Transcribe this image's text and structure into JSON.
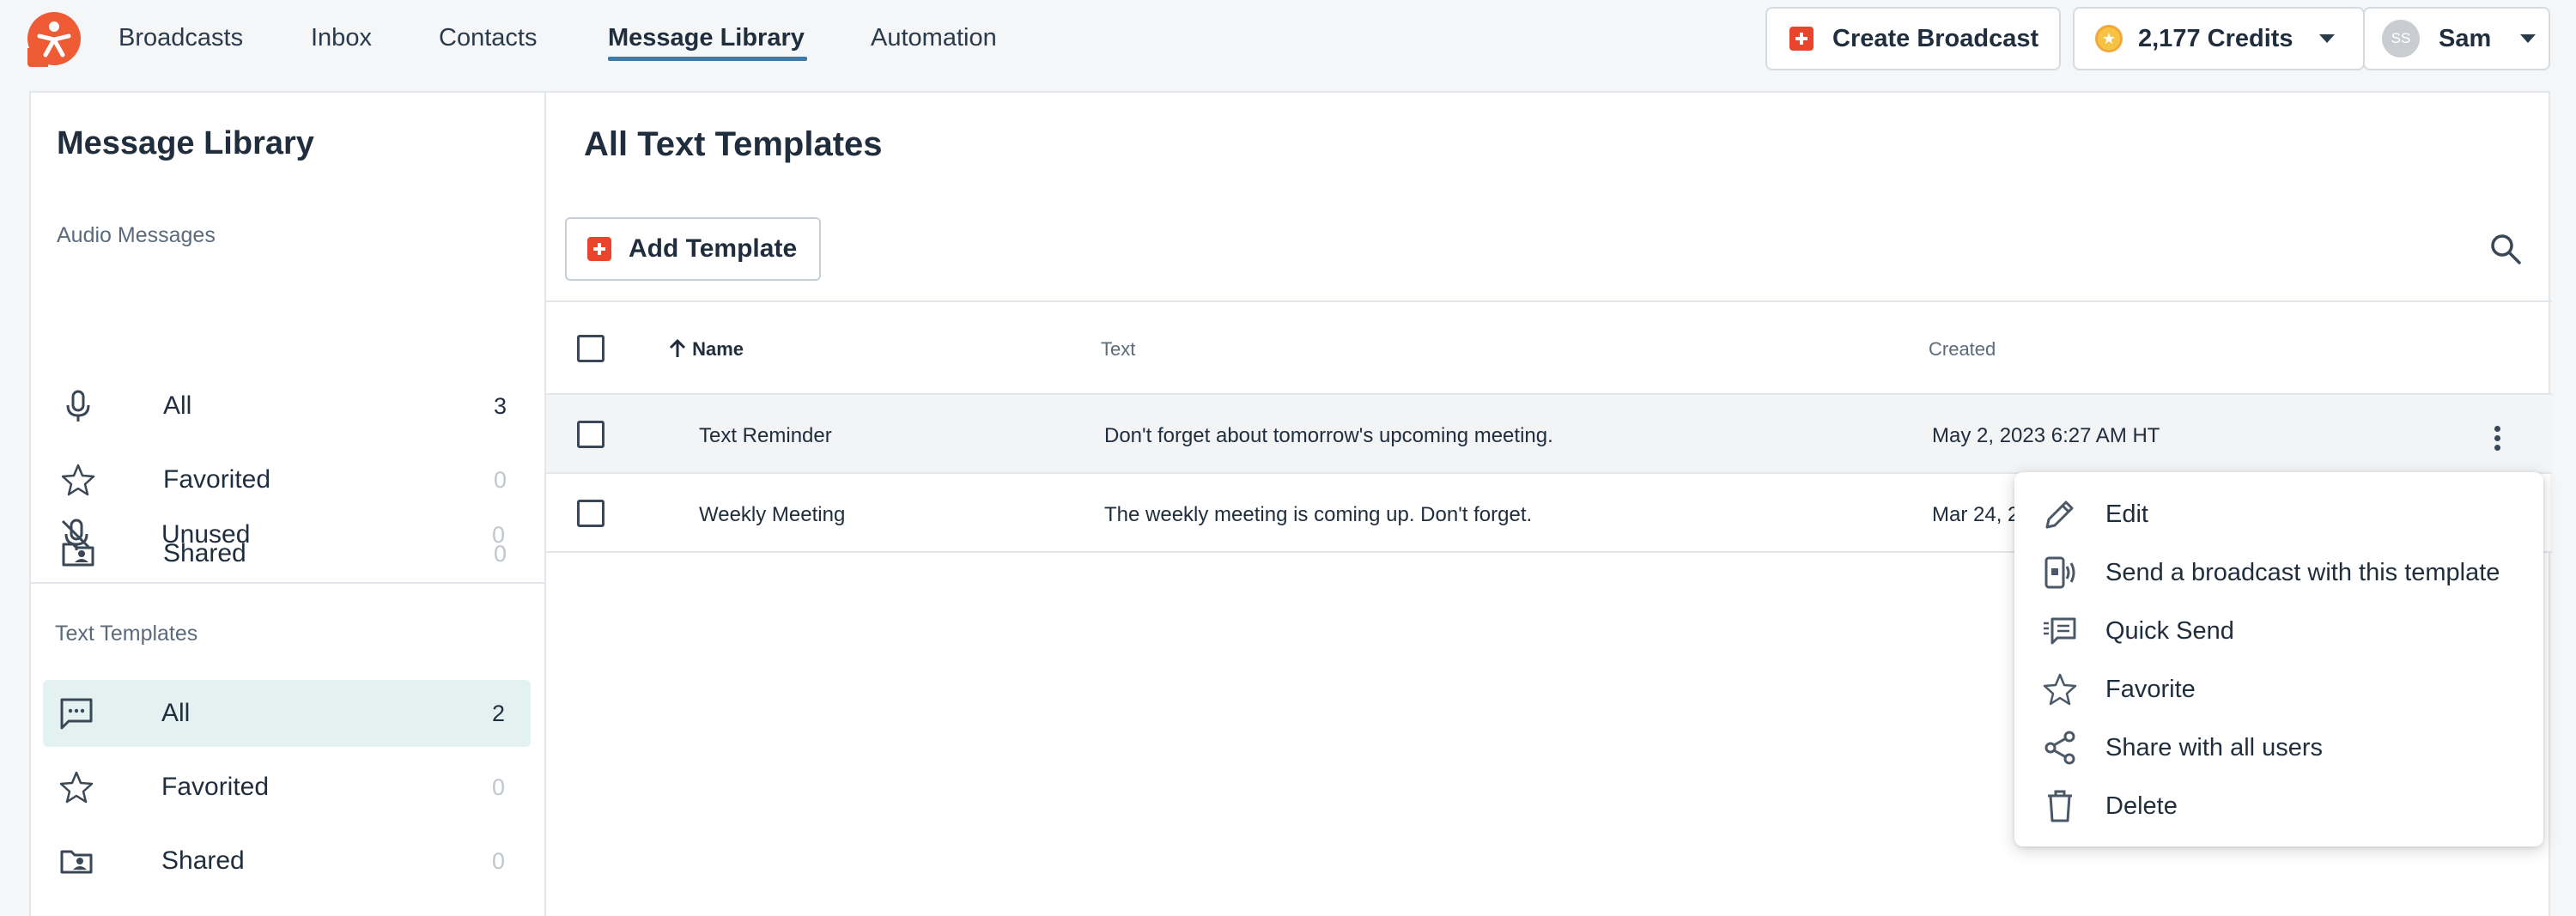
{
  "nav": {
    "items": [
      {
        "label": "Broadcasts"
      },
      {
        "label": "Inbox"
      },
      {
        "label": "Contacts"
      },
      {
        "label": "Message Library"
      },
      {
        "label": "Automation"
      }
    ],
    "active": "Message Library"
  },
  "header": {
    "create_broadcast": "Create Broadcast",
    "credits": "2,177 Credits",
    "user_initials": "SS",
    "user_name": "Sam"
  },
  "sidebar": {
    "title": "Message Library",
    "audio_section": "Audio Messages",
    "audio_items": [
      {
        "label": "All",
        "count": "3",
        "icon": "microphone-icon"
      },
      {
        "label": "Favorited",
        "count": "0",
        "icon": "star-icon"
      },
      {
        "label": "Shared",
        "count": "0",
        "icon": "shared-folder-icon"
      },
      {
        "label": "Unused",
        "count": "0",
        "icon": "microphone-off-icon"
      }
    ],
    "text_section": "Text Templates",
    "text_items": [
      {
        "label": "All",
        "count": "2",
        "icon": "message-icon"
      },
      {
        "label": "Favorited",
        "count": "0",
        "icon": "star-icon"
      },
      {
        "label": "Shared",
        "count": "0",
        "icon": "shared-folder-icon"
      }
    ]
  },
  "main": {
    "title": "All Text Templates",
    "add_template": "Add Template",
    "columns": {
      "name": "Name",
      "text": "Text",
      "created": "Created"
    },
    "rows": [
      {
        "name": "Text Reminder",
        "text": "Don't forget about tomorrow's upcoming meeting.",
        "created": "May 2, 2023 6:27 AM HT"
      },
      {
        "name": "Weekly Meeting",
        "text": "The weekly meeting is coming up. Don't forget.",
        "created": "Mar 24, 2"
      }
    ]
  },
  "menu": {
    "items": [
      {
        "label": "Edit",
        "icon": "pencil-icon"
      },
      {
        "label": "Send a broadcast with this template",
        "icon": "broadcast-phone-icon"
      },
      {
        "label": "Quick Send",
        "icon": "quick-send-icon"
      },
      {
        "label": "Favorite",
        "icon": "star-icon"
      },
      {
        "label": "Share with all users",
        "icon": "share-icon"
      },
      {
        "label": "Delete",
        "icon": "trash-icon"
      }
    ]
  },
  "colors": {
    "accent": "#ef5b34",
    "active_nav_underline": "#3d7ba6",
    "sidebar_active_bg": "#e3f2f0",
    "coin": "#f6c342"
  }
}
